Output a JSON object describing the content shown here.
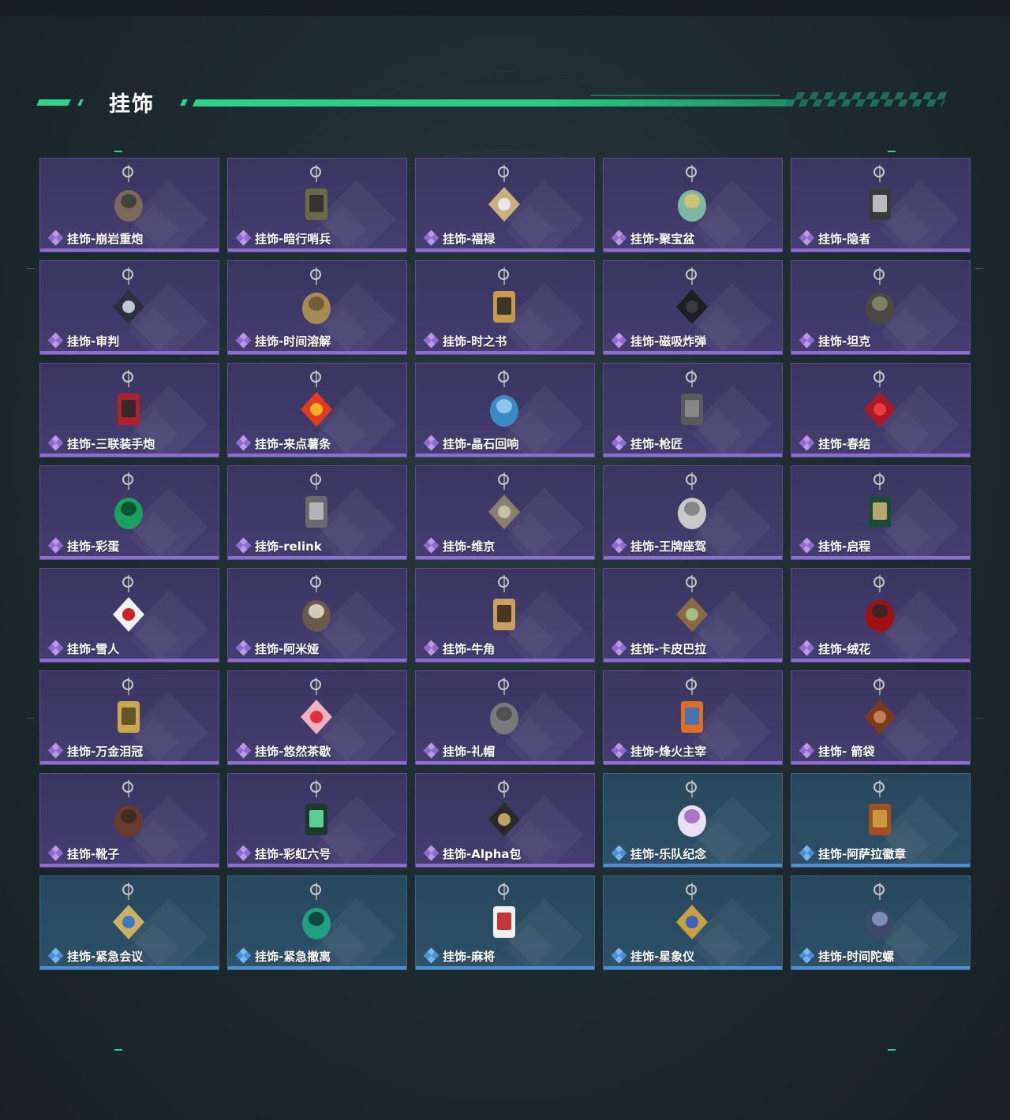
{
  "header": {
    "title": "挂饰"
  },
  "colors": {
    "accent_green": "#2fd28f",
    "card_purple": "#403a6a",
    "card_purple_bar": "#8f6cd0",
    "card_blue": "#2b4c63",
    "card_blue_bar": "#4a8fd8"
  },
  "items": [
    {
      "name": "挂饰-崩岩重炮",
      "rarity": "purple",
      "icon": "rock-gunner-charm-icon"
    },
    {
      "name": "挂饰-暗行哨兵",
      "rarity": "purple",
      "icon": "sentinel-charm-icon"
    },
    {
      "name": "挂饰-福禄",
      "rarity": "purple",
      "icon": "gourd-charm-icon"
    },
    {
      "name": "挂饰-聚宝盆",
      "rarity": "purple",
      "icon": "treasure-bowl-charm-icon"
    },
    {
      "name": "挂饰-隐者",
      "rarity": "purple",
      "icon": "hermit-card-charm-icon"
    },
    {
      "name": "挂饰-审判",
      "rarity": "purple",
      "icon": "judgement-card-charm-icon"
    },
    {
      "name": "挂饰-时间溶解",
      "rarity": "purple",
      "icon": "melting-clock-charm-icon"
    },
    {
      "name": "挂饰-时之书",
      "rarity": "purple",
      "icon": "book-charm-icon"
    },
    {
      "name": "挂饰-磁吸炸弹",
      "rarity": "purple",
      "icon": "magnetic-bomb-charm-icon"
    },
    {
      "name": "挂饰-坦克",
      "rarity": "purple",
      "icon": "tank-charm-icon"
    },
    {
      "name": "挂饰-三联装手炮",
      "rarity": "purple",
      "icon": "hand-cannon-charm-icon"
    },
    {
      "name": "挂饰-来点薯条",
      "rarity": "purple",
      "icon": "fries-charm-icon"
    },
    {
      "name": "挂饰-晶石回响",
      "rarity": "purple",
      "icon": "crystal-charm-icon"
    },
    {
      "name": "挂饰-枪匠",
      "rarity": "purple",
      "icon": "gunsmith-charm-icon"
    },
    {
      "name": "挂饰-春结",
      "rarity": "purple",
      "icon": "chinese-knot-charm-icon"
    },
    {
      "name": "挂饰-彩蛋",
      "rarity": "purple",
      "icon": "easter-egg-charm-icon"
    },
    {
      "name": "挂饰-relink",
      "rarity": "purple",
      "icon": "relink-charm-icon"
    },
    {
      "name": "挂饰-维京",
      "rarity": "purple",
      "icon": "viking-hammer-charm-icon"
    },
    {
      "name": "挂饰-王牌座驾",
      "rarity": "purple",
      "icon": "jet-charm-icon"
    },
    {
      "name": "挂饰-启程",
      "rarity": "purple",
      "icon": "compass-charm-icon"
    },
    {
      "name": "挂饰-雪人",
      "rarity": "purple",
      "icon": "snowman-charm-icon"
    },
    {
      "name": "挂饰-阿米娅",
      "rarity": "purple",
      "icon": "bunny-charm-icon"
    },
    {
      "name": "挂饰-牛角",
      "rarity": "purple",
      "icon": "bull-horn-charm-icon"
    },
    {
      "name": "挂饰-卡皮巴拉",
      "rarity": "purple",
      "icon": "capybara-charm-icon"
    },
    {
      "name": "挂饰-绒花",
      "rarity": "purple",
      "icon": "rose-charm-icon"
    },
    {
      "name": "挂饰-万金泪冠",
      "rarity": "purple",
      "icon": "crown-charm-icon"
    },
    {
      "name": "挂饰-悠然茶歇",
      "rarity": "purple",
      "icon": "cupcake-charm-icon"
    },
    {
      "name": "挂饰-礼帽",
      "rarity": "purple",
      "icon": "fedora-charm-icon"
    },
    {
      "name": "挂饰-烽火主宰",
      "rarity": "purple",
      "icon": "banner-charm-icon"
    },
    {
      "name": "挂饰- 箭袋",
      "rarity": "purple",
      "icon": "quiver-charm-icon"
    },
    {
      "name": "挂饰-靴子",
      "rarity": "purple",
      "icon": "boot-charm-icon"
    },
    {
      "name": "挂饰-彩虹六号",
      "rarity": "purple",
      "icon": "six-charm-icon"
    },
    {
      "name": "挂饰-Alpha包",
      "rarity": "purple",
      "icon": "alpha-pack-charm-icon"
    },
    {
      "name": "挂饰-乐队纪念",
      "rarity": "blue",
      "icon": "band-badge-charm-icon"
    },
    {
      "name": "挂饰-阿萨拉徽章",
      "rarity": "blue",
      "icon": "asala-badge-charm-icon"
    },
    {
      "name": "挂饰-紧急会议",
      "rarity": "blue",
      "icon": "emergency-meeting-charm-icon"
    },
    {
      "name": "挂饰-紧急撤离",
      "rarity": "blue",
      "icon": "evacuation-charm-icon"
    },
    {
      "name": "挂饰-麻将",
      "rarity": "blue",
      "icon": "mahjong-charm-icon"
    },
    {
      "name": "挂饰-星象仪",
      "rarity": "blue",
      "icon": "astrolabe-charm-icon"
    },
    {
      "name": "挂饰-时间陀螺",
      "rarity": "blue",
      "icon": "gyroscope-charm-icon"
    }
  ]
}
